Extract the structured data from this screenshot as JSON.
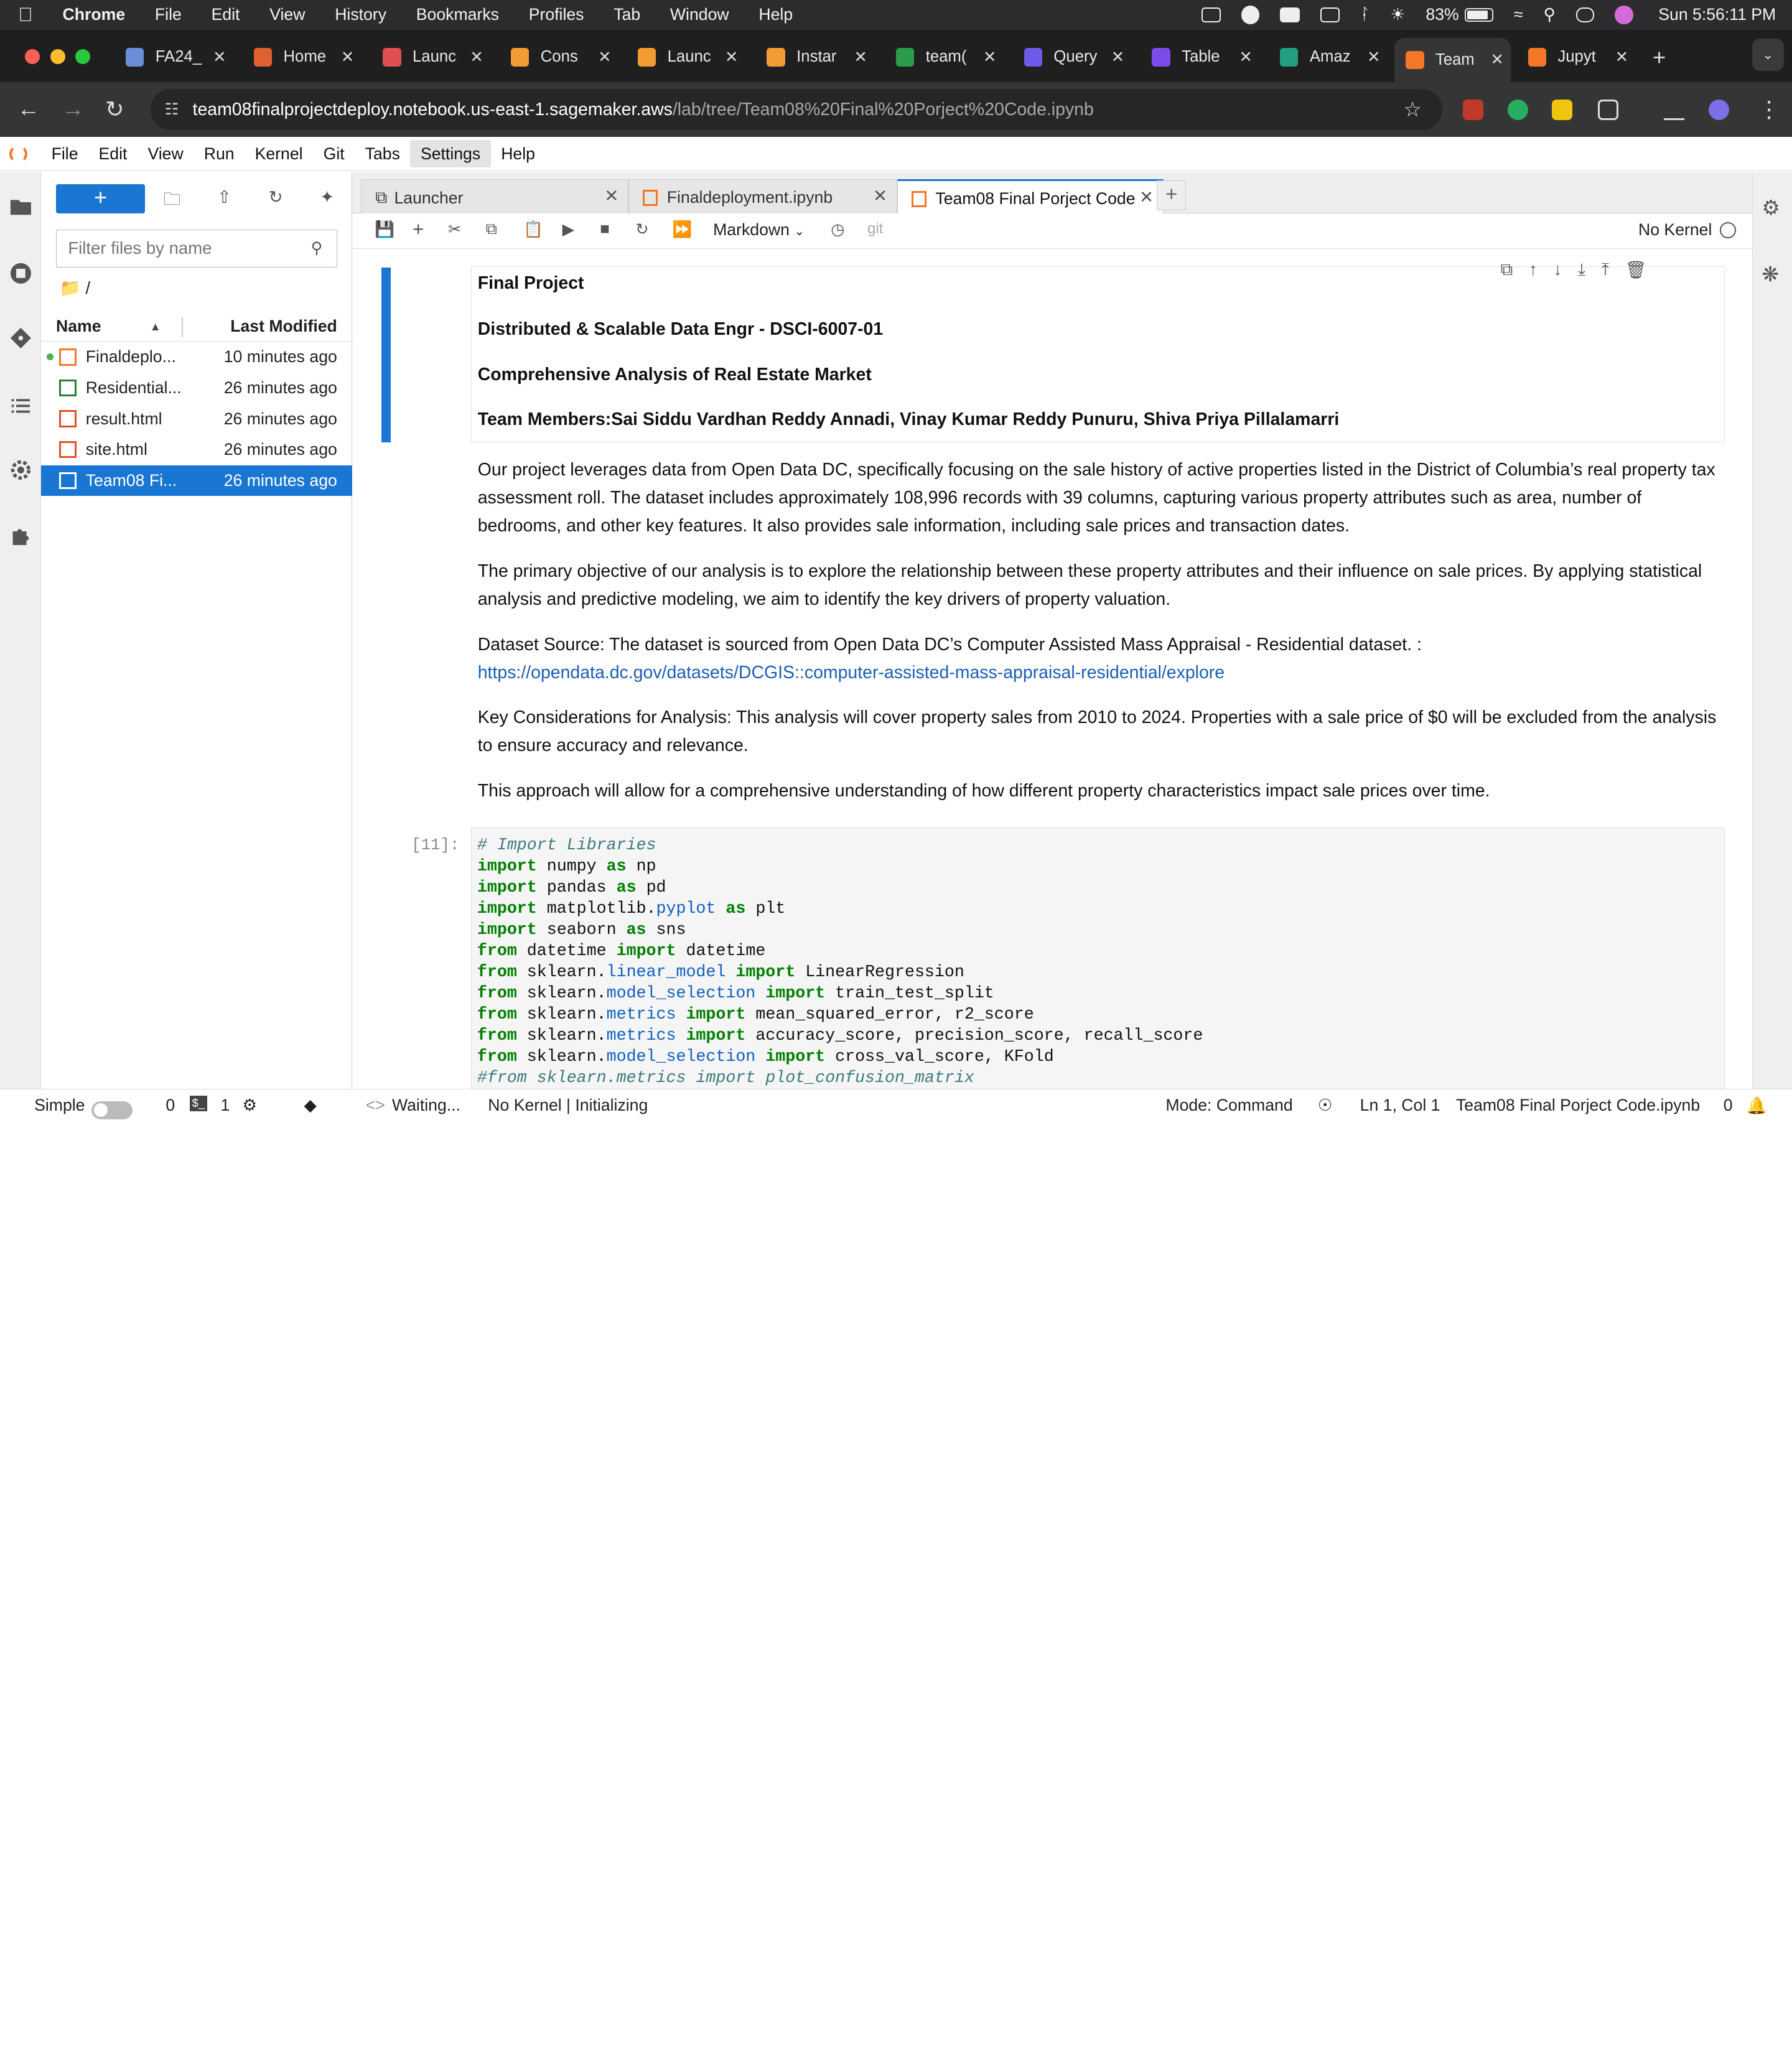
{
  "macos": {
    "app": "Chrome",
    "menu": [
      "File",
      "Edit",
      "View",
      "History",
      "Bookmarks",
      "Profiles",
      "Tab",
      "Window",
      "Help"
    ],
    "battery": "83%",
    "clock": "Sun 5:56:11 PM"
  },
  "browser": {
    "tabs": [
      {
        "label": "FA24_",
        "color": "#6a8fd8"
      },
      {
        "label": "Home",
        "color": "#e06030"
      },
      {
        "label": "Launc",
        "color": "#e05050"
      },
      {
        "label": "Cons",
        "color": "#f39c33"
      },
      {
        "label": "Launc",
        "color": "#f39c33"
      },
      {
        "label": "Instar",
        "color": "#f39c33"
      },
      {
        "label": "team(",
        "color": "#2a9d4a"
      },
      {
        "label": "Query",
        "color": "#6c5ce7"
      },
      {
        "label": "Table",
        "color": "#7b4ce7"
      },
      {
        "label": "Amaz",
        "color": "#20a080"
      },
      {
        "label": "Team",
        "color": "#f37726"
      },
      {
        "label": "Jupyt",
        "color": "#f37726"
      }
    ],
    "url_host": "team08finalprojectdeploy.notebook.us-east-1.sagemaker.aws",
    "url_path": "/lab/tree/Team08%20Final%20Porject%20Code.ipynb"
  },
  "jupyter_menu": [
    "File",
    "Edit",
    "View",
    "Run",
    "Kernel",
    "Git",
    "Tabs",
    "Settings",
    "Help"
  ],
  "filebrowser": {
    "filter_placeholder": "Filter files by name",
    "path": "/",
    "col_name": "Name",
    "col_modified": "Last Modified",
    "files": [
      {
        "name": "Finaldeplo...",
        "modified": "10 minutes ago",
        "type": "notebook",
        "running": true,
        "selected": false
      },
      {
        "name": "Residential...",
        "modified": "26 minutes ago",
        "type": "csv",
        "running": false,
        "selected": false
      },
      {
        "name": "result.html",
        "modified": "26 minutes ago",
        "type": "html",
        "running": false,
        "selected": false
      },
      {
        "name": "site.html",
        "modified": "26 minutes ago",
        "type": "html",
        "running": false,
        "selected": false
      },
      {
        "name": "Team08 Fi...",
        "modified": "26 minutes ago",
        "type": "notebook",
        "running": false,
        "selected": true
      }
    ]
  },
  "doc_tabs": [
    {
      "label": "Launcher"
    },
    {
      "label": "Finaldeployment.ipynb"
    },
    {
      "label": "Team08 Final Porject Code"
    }
  ],
  "toolbar": {
    "cell_type": "Markdown",
    "git": "git",
    "kernel": "No Kernel"
  },
  "notebook": {
    "heading_lines": [
      "Final Project",
      "Distributed & Scalable Data Engr - DSCI-6007-01",
      "Comprehensive Analysis of Real Estate Market",
      "Team Members:Sai Siddu Vardhan Reddy Annadi, Vinay Kumar Reddy Punuru, Shiva Priya Pillalamarri"
    ],
    "para1": "Our project leverages data from Open Data DC, specifically focusing on the sale history of active properties listed in the District of Columbia’s real property tax assessment roll. The dataset includes approximately 108,996 records with 39 columns, capturing various property attributes such as area, number of bedrooms, and other key features. It also provides sale information, including sale prices and transaction dates.",
    "para2": "The primary objective of our analysis is to explore the relationship between these property attributes and their influence on sale prices. By applying statistical analysis and predictive modeling, we aim to identify the key drivers of property valuation.",
    "para3_text": "Dataset Source: The dataset is sourced from Open Data DC’s Computer Assisted Mass Appraisal - Residential dataset. :",
    "para3_link": "https://opendata.dc.gov/datasets/DCGIS::computer-assisted-mass-appraisal-residential/explore",
    "para4": "Key Considerations for Analysis: This analysis will cover property sales from 2010 to 2024. Properties with a sale price of $0 will be excluded from the analysis to ensure accuracy and relevance.",
    "para5": "This approach will allow for a comprehensive understanding of how different property characteristics impact sale prices over time.",
    "code_prompt": "[11]:",
    "code_lines": [
      "# Import Libraries",
      "import numpy as np",
      "import pandas as pd",
      "import matplotlib.pyplot as plt",
      "import seaborn as sns",
      "from datetime import datetime",
      "from sklearn.linear_model import LinearRegression",
      "from sklearn.model_selection import train_test_split",
      "from sklearn.metrics import mean_squared_error, r2_score",
      "from sklearn.metrics import accuracy_score, precision_score, recall_score",
      "from sklearn.model_selection import cross_val_score, KFold",
      "#from sklearn.metrics import plot_confusion_matrix"
    ]
  },
  "status": {
    "mode_label": "Simple",
    "terminals": "0",
    "kernels": "1",
    "waiting": "Waiting...",
    "kernel_status": "No Kernel | Initializing",
    "mode": "Mode: Command",
    "position": "Ln 1, Col 1",
    "filename": "Team08 Final Porject Code.ipynb",
    "notifications": "0"
  }
}
